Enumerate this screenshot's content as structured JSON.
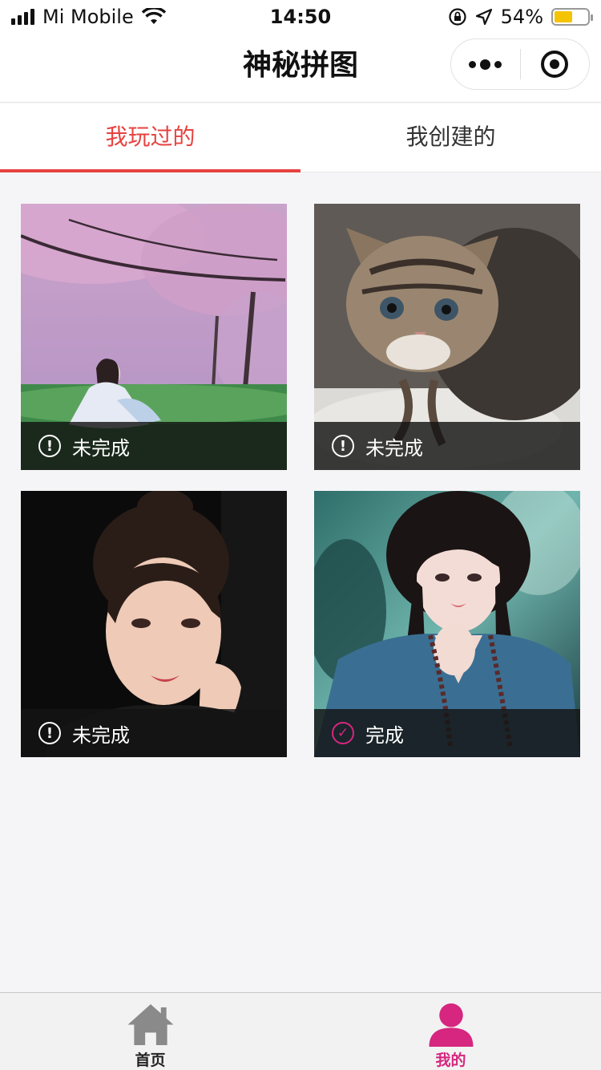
{
  "status_bar": {
    "carrier": "Mi Mobile",
    "time": "14:50",
    "battery": "54%",
    "battery_level": 0.54
  },
  "nav": {
    "title": "神秘拼图"
  },
  "tabs": [
    {
      "label": "我玩过的",
      "active": true
    },
    {
      "label": "我创建的",
      "active": false
    }
  ],
  "puzzles": [
    {
      "photo": "woman-under-cherry-blossoms",
      "status": "未完成",
      "status_icon": "exclamation-circle-icon"
    },
    {
      "photo": "tabby-kitten",
      "status": "未完成",
      "status_icon": "exclamation-circle-icon"
    },
    {
      "photo": "woman-portrait-dark-background",
      "status": "未完成",
      "status_icon": "exclamation-circle-icon"
    },
    {
      "photo": "woman-portrait-teal-background",
      "status": "完成",
      "status_icon": "check-circle-icon"
    }
  ],
  "tabbar": {
    "items": [
      {
        "label": "首页",
        "icon": "home-icon",
        "color": "#8a8a8a",
        "label_color": "#222222",
        "active": false
      },
      {
        "label": "我的",
        "icon": "user-icon",
        "color": "#d6267f",
        "label_color": "#d6267f",
        "active": true
      }
    ]
  },
  "colors": {
    "accent_tab": "#e64340",
    "accent_brand": "#d6267f",
    "battery_fill": "#f5c400"
  }
}
